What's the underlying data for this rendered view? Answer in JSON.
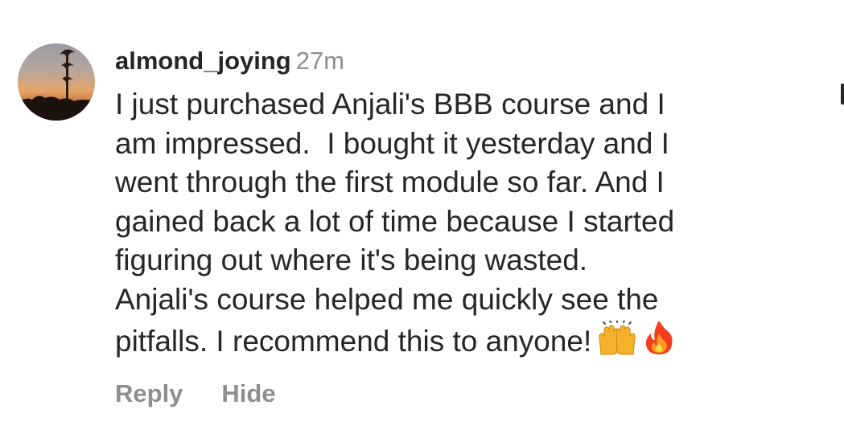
{
  "comment": {
    "username": "almond_joying",
    "timestamp": "27m",
    "text_lines": [
      "I just purchased Anjali's BBB course and I",
      "am impressed.  I bought it yesterday and I",
      "went through the first module so far. And I",
      "gained back a lot of time because I started",
      "figuring out where it's being wasted.",
      "Anjali's course helped me quickly see the",
      "pitfalls. I recommend this to anyone!"
    ],
    "emojis": [
      "raising-hands-icon",
      "fire-icon"
    ],
    "actions": {
      "reply_label": "Reply",
      "hide_label": "Hide"
    }
  },
  "colors": {
    "text": "#262626",
    "secondary": "#8e8e8e",
    "background": "#ffffff"
  }
}
